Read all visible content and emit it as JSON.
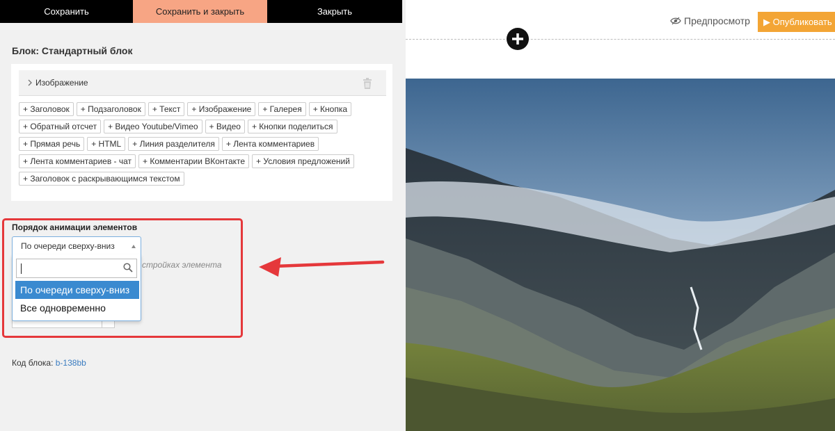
{
  "toolbar": {
    "save_label": "Сохранить",
    "save_close_label": "Сохранить и закрыть",
    "close_label": "Закрыть"
  },
  "block_title": "Блок: Стандартный блок",
  "element_item": {
    "label": "Изображение"
  },
  "add_buttons": [
    [
      "+ Заголовок",
      "+ Подзаголовок",
      "+ Текст",
      "+ Изображение",
      "+ Галерея",
      "+ Кнопка"
    ],
    [
      "+ Обратный отсчет",
      "+ Видео Youtube/Vimeo",
      "+ Видео",
      "+ Кнопки поделиться"
    ],
    [
      "+ Прямая речь",
      "+ HTML",
      "+ Линия разделителя",
      "+ Лента комментариев"
    ],
    [
      "+ Лента комментариев - чат",
      "+ Комментарии ВКонтакте",
      "+ Условия предложений"
    ],
    [
      "+ Заголовок с раскрывающимся текстом"
    ]
  ],
  "animation": {
    "label": "Порядок анимации элементов",
    "selected": "По очереди сверху-вниз",
    "options": [
      "По очереди сверху-вниз",
      "Все одновременно"
    ],
    "search_value": "",
    "hint_text": "стройках элемента"
  },
  "block_code": {
    "label": "Код блока:",
    "value": "b-138bb"
  },
  "preview": {
    "preview_label": "Предпросмотр",
    "publish_label": "▶ Опубликовать и"
  },
  "colors": {
    "accent_save_close": "#f7a584",
    "publish": "#f3a535",
    "highlight_frame": "#e5383b",
    "selected_option": "#3a8ad0"
  },
  "icons": [
    "chevron-right-icon",
    "trash-icon",
    "search-icon",
    "eye-icon",
    "plus-icon",
    "red-arrow"
  ]
}
